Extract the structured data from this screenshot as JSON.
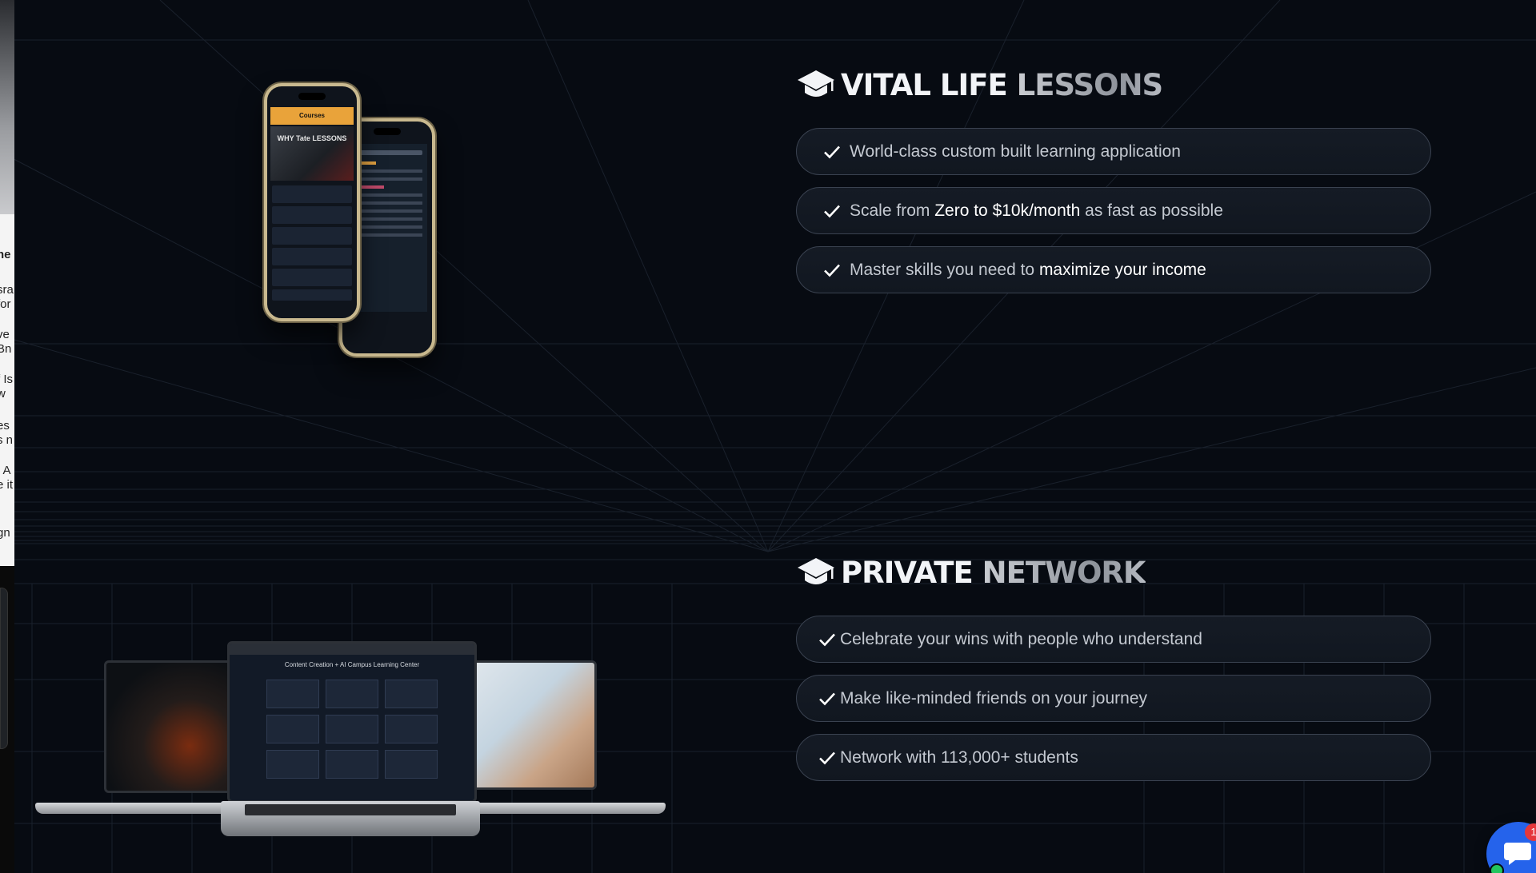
{
  "sections": [
    {
      "title_primary": "VITAL LIFE",
      "title_secondary": "LESSONS",
      "icon": "graduation-cap-icon",
      "items": [
        {
          "parts": [
            {
              "text": "World-class custom built learning application",
              "hl": false
            }
          ]
        },
        {
          "parts": [
            {
              "text": "Scale from ",
              "hl": false
            },
            {
              "text": "Zero to $10k/month",
              "hl": true
            },
            {
              "text": " as fast as possible",
              "hl": false
            }
          ]
        },
        {
          "parts": [
            {
              "text": "Master skills you need to ",
              "hl": false
            },
            {
              "text": "maximize your income",
              "hl": true
            }
          ]
        }
      ]
    },
    {
      "title_primary": "PRIVATE",
      "title_secondary": "NETWORK",
      "icon": "graduation-cap-icon",
      "items": [
        {
          "parts": [
            {
              "text": "Celebrate your wins with people who understand",
              "hl": false
            }
          ]
        },
        {
          "parts": [
            {
              "text": "Make like-minded friends on your journey",
              "hl": false
            }
          ]
        },
        {
          "parts": [
            {
              "text": "Network with 113,000+ students",
              "hl": false
            }
          ]
        }
      ]
    }
  ],
  "mockups": {
    "phone_header": "Courses",
    "phone_poster": "WHY Tate LESSONS",
    "laptop_title": "Content Creation + AI Campus Learning Center"
  },
  "left_sliver_lines": [
    "ne",
    "sra",
    "for",
    "ve",
    "Bn",
    "f Is",
    "w",
    "es",
    "s n",
    ", A",
    "e it",
    "gn"
  ],
  "chat_widget": {
    "badge": "1",
    "icon": "chat-icon"
  },
  "colors": {
    "background": "#070b12",
    "pill_border": "#3a4250",
    "text_muted": "#c4c9d1",
    "text_highlight": "#ffffff",
    "chat_blue": "#2563eb",
    "badge_red": "#e5383b"
  }
}
